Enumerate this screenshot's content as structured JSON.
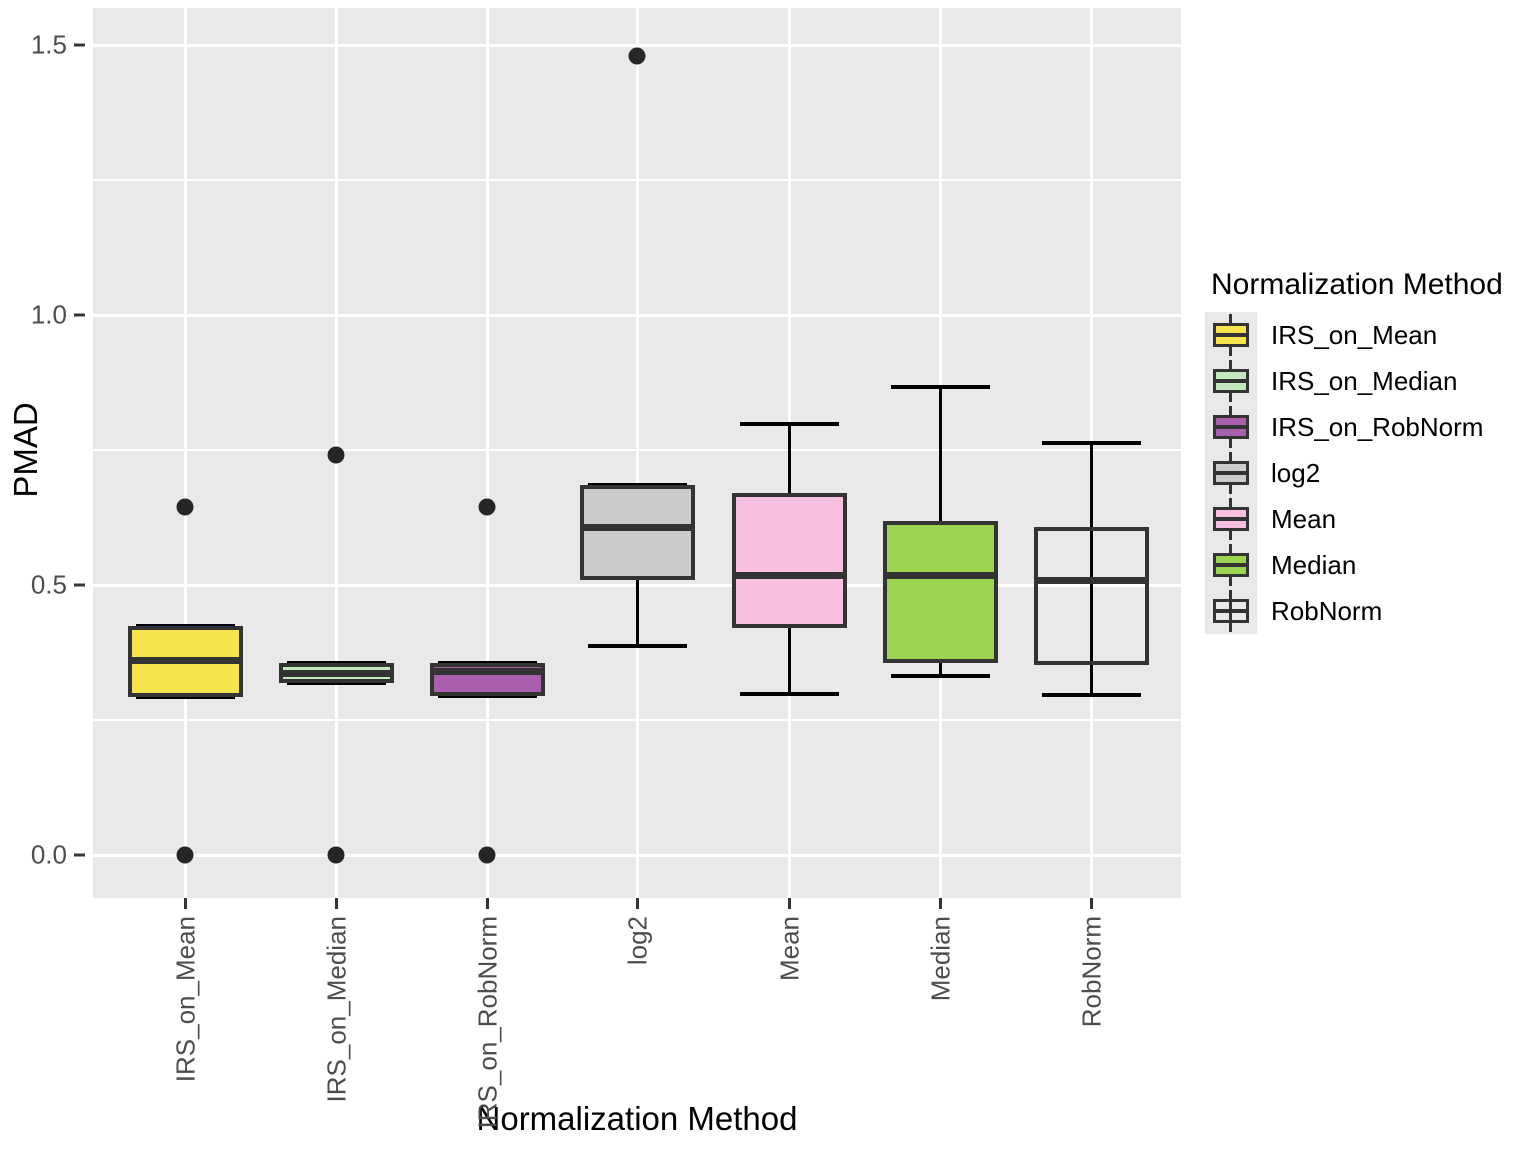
{
  "axes": {
    "y_title": "PMAD",
    "x_title": "Normalization Method",
    "y_ticks": [
      "0.0",
      "0.5",
      "1.0",
      "1.5"
    ],
    "x_ticks": [
      "IRS_on_Mean",
      "IRS_on_Median",
      "IRS_on_RobNorm",
      "log2",
      "Mean",
      "Median",
      "RobNorm"
    ]
  },
  "legend": {
    "title": "Normalization Method",
    "items": [
      {
        "label": "IRS_on_Mean",
        "color": "#f7e44c"
      },
      {
        "label": "IRS_on_Median",
        "color": "#c4e8bd"
      },
      {
        "label": "IRS_on_RobNorm",
        "color": "#aa5fac"
      },
      {
        "label": "log2",
        "color": "#cccccc"
      },
      {
        "label": "Mean",
        "color": "#f7c0e0"
      },
      {
        "label": "Median",
        "color": "#9bd44e"
      },
      {
        "label": "RobNorm",
        "color": "#f9a council"
      }
    ]
  },
  "chart_data": {
    "type": "box",
    "title": "",
    "xlabel": "Normalization Method",
    "ylabel": "PMAD",
    "ylim": [
      -0.06,
      1.58
    ],
    "y_ticks": [
      0.0,
      0.5,
      1.0,
      1.5
    ],
    "y_minor_ticks": [
      0.25,
      0.75,
      1.25
    ],
    "grid": true,
    "legend_position": "right",
    "legend_title": "Normalization Method",
    "categories": [
      "IRS_on_Mean",
      "IRS_on_Median",
      "IRS_on_RobNorm",
      "log2",
      "Mean",
      "Median",
      "RobNorm"
    ],
    "boxes": [
      {
        "category": "IRS_on_Mean",
        "color": "#f7e44c",
        "lower_whisker": 0.292,
        "q1": 0.292,
        "median": 0.361,
        "q3": 0.425,
        "upper_whisker": 0.425,
        "outliers": [
          0.645,
          0.0
        ]
      },
      {
        "category": "IRS_on_Median",
        "color": "#c4e8bd",
        "lower_whisker": 0.318,
        "q1": 0.318,
        "median": 0.337,
        "q3": 0.355,
        "upper_whisker": 0.355,
        "outliers": [
          0.741,
          0.0
        ]
      },
      {
        "category": "IRS_on_RobNorm",
        "color": "#aa5fac",
        "lower_whisker": 0.295,
        "q1": 0.295,
        "median": 0.341,
        "q3": 0.355,
        "upper_whisker": 0.355,
        "outliers": [
          0.645,
          0.0
        ]
      },
      {
        "category": "log2",
        "color": "#cccccc",
        "lower_whisker": 0.387,
        "q1": 0.509,
        "median": 0.607,
        "q3": 0.685,
        "upper_whisker": 0.685,
        "outliers": [
          1.48
        ]
      },
      {
        "category": "Mean",
        "color": "#f7c0e0",
        "lower_whisker": 0.298,
        "q1": 0.42,
        "median": 0.519,
        "q3": 0.67,
        "upper_whisker": 0.798,
        "outliers": []
      },
      {
        "category": "Median",
        "color": "#9bd44e",
        "lower_whisker": 0.332,
        "q1": 0.356,
        "median": 0.519,
        "q3": 0.619,
        "upper_whisker": 0.867,
        "outliers": []
      },
      {
        "category": "RobNorm",
        "color": "#f9a council",
        "lower_whisker": 0.296,
        "q1": 0.352,
        "median": 0.509,
        "q3": 0.607,
        "upper_whisker": 0.763,
        "outliers": []
      }
    ]
  }
}
